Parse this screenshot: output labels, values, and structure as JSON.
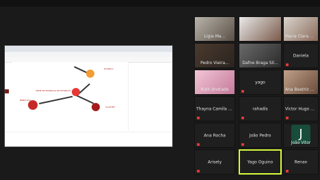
{
  "screen_share": {
    "diagram": {
      "labels": [
        "ESTRELA",
        "REDE DE ESTRELAS DE ESTRELAS",
        "CLUSTER",
        "NEBULOSA"
      ]
    }
  },
  "participants": [
    {
      "name": "Ligia Ma..."
    },
    {
      "name": ""
    },
    {
      "name": "Maria Clara H..."
    },
    {
      "name": "Pedro Vieira..."
    },
    {
      "name": "Dafne Braga Sil..."
    },
    {
      "name": "Daniela"
    },
    {
      "name": "Ruth Andrade"
    },
    {
      "name": "yago"
    },
    {
      "name": "Ana Beatriz C..."
    },
    {
      "name": "Thayna Camila I..."
    },
    {
      "name": "rahadis"
    },
    {
      "name": "Victor Hugo Pa..."
    },
    {
      "name": "Ana Rocha"
    },
    {
      "name": "João Pedro"
    },
    {
      "name": "João Vitor",
      "avatar_letter": "J"
    },
    {
      "name": "Arisely"
    },
    {
      "name": "Yago Oguino"
    },
    {
      "name": "Renan"
    }
  ]
}
